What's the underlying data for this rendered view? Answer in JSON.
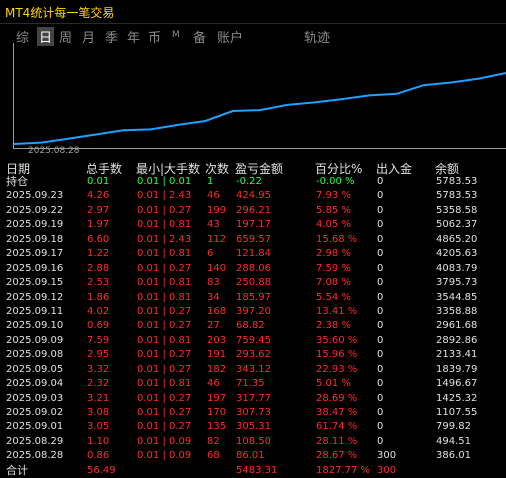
{
  "window": {
    "title": "MT4统计每一笔交易"
  },
  "tabs": [
    {
      "label": "综",
      "active": false
    },
    {
      "label": "日",
      "active": true
    },
    {
      "label": "周",
      "active": false
    },
    {
      "label": "月",
      "active": false
    },
    {
      "label": "季",
      "active": false
    },
    {
      "label": "年",
      "active": false
    },
    {
      "label": "币",
      "active": false
    },
    {
      "label": "M",
      "active": false
    },
    {
      "label": "备",
      "active": false
    },
    {
      "label": "账户",
      "active": false
    },
    {
      "label": "轨迹",
      "active": false
    }
  ],
  "chart_data": {
    "type": "line",
    "x_start_label": "2025.08.28",
    "series": [
      {
        "values": [
          386.01,
          494.51,
          799.82,
          1107.55,
          1425.32,
          1496.67,
          1839.79,
          2133.41,
          2892.86,
          2961.68,
          3358.88,
          3544.85,
          3795.73,
          4083.79,
          4205.63,
          4865.2,
          5062.37,
          5358.58,
          5783.53
        ]
      }
    ],
    "color": "#1ea0ff"
  },
  "table": {
    "headers": [
      "日期",
      "总手数",
      "最小|大手数",
      "次数",
      "盈亏金额",
      "百分比%",
      "出入金",
      "余额"
    ],
    "rows": [
      {
        "style": "pos",
        "cells": [
          "持仓",
          "0.01",
          "0.01 | 0.01",
          "1",
          "-0.22",
          "-0.00 %",
          "0",
          "5783.53"
        ]
      },
      {
        "style": "red",
        "cells": [
          "2025.09.23",
          "4.26",
          "0.01 | 2.43",
          "46",
          "424.95",
          "7.93 %",
          "0",
          "5783.53"
        ]
      },
      {
        "style": "red",
        "cells": [
          "2025.09.22",
          "2.97",
          "0.01 | 0.27",
          "199",
          "296.21",
          "5.85 %",
          "0",
          "5358.58"
        ]
      },
      {
        "style": "red",
        "cells": [
          "2025.09.19",
          "1.97",
          "0.01 | 0.81",
          "43",
          "197.17",
          "4.05 %",
          "0",
          "5062.37"
        ]
      },
      {
        "style": "red",
        "cells": [
          "2025.09.18",
          "6.60",
          "0.01 | 2.43",
          "112",
          "659.57",
          "15.68 %",
          "0",
          "4865.20"
        ]
      },
      {
        "style": "red",
        "cells": [
          "2025.09.17",
          "1.22",
          "0.01 | 0.81",
          "6",
          "121.84",
          "2.98 %",
          "0",
          "4205.63"
        ]
      },
      {
        "style": "red",
        "cells": [
          "2025.09.16",
          "2.88",
          "0.01 | 0.27",
          "140",
          "288.06",
          "7.59 %",
          "0",
          "4083.79"
        ]
      },
      {
        "style": "red",
        "cells": [
          "2025.09.15",
          "2.53",
          "0.01 | 0.81",
          "83",
          "250.88",
          "7.08 %",
          "0",
          "3795.73"
        ]
      },
      {
        "style": "red",
        "cells": [
          "2025.09.12",
          "1.86",
          "0.01 | 0.81",
          "34",
          "185.97",
          "5.54 %",
          "0",
          "3544.85"
        ]
      },
      {
        "style": "red",
        "cells": [
          "2025.09.11",
          "4.02",
          "0.01 | 0.27",
          "168",
          "397.20",
          "13.41 %",
          "0",
          "3358.88"
        ]
      },
      {
        "style": "red",
        "cells": [
          "2025.09.10",
          "0.69",
          "0.01 | 0.27",
          "27",
          "68.82",
          "2.38 %",
          "0",
          "2961.68"
        ]
      },
      {
        "style": "red",
        "cells": [
          "2025.09.09",
          "7.59",
          "0.01 | 0.81",
          "203",
          "759.45",
          "35.60 %",
          "0",
          "2892.86"
        ]
      },
      {
        "style": "red",
        "cells": [
          "2025.09.08",
          "2.95",
          "0.01 | 0.27",
          "191",
          "293.62",
          "15.96 %",
          "0",
          "2133.41"
        ]
      },
      {
        "style": "red",
        "cells": [
          "2025.09.05",
          "3.32",
          "0.01 | 0.27",
          "182",
          "343.12",
          "22.93 %",
          "0",
          "1839.79"
        ]
      },
      {
        "style": "red",
        "cells": [
          "2025.09.04",
          "2.32",
          "0.01 | 0.81",
          "46",
          "71.35",
          "5.01 %",
          "0",
          "1496.67"
        ]
      },
      {
        "style": "red",
        "cells": [
          "2025.09.03",
          "3.21",
          "0.01 | 0.27",
          "197",
          "317.77",
          "28.69 %",
          "0",
          "1425.32"
        ]
      },
      {
        "style": "red",
        "cells": [
          "2025.09.02",
          "3.08",
          "0.01 | 0.27",
          "170",
          "307.73",
          "38.47 %",
          "0",
          "1107.55"
        ]
      },
      {
        "style": "red",
        "cells": [
          "2025.09.01",
          "3.05",
          "0.01 | 0.27",
          "135",
          "305.31",
          "61.74 %",
          "0",
          "799.82"
        ]
      },
      {
        "style": "red",
        "cells": [
          "2025.08.29",
          "1.10",
          "0.01 | 0.09",
          "82",
          "108.50",
          "28.11 %",
          "0",
          "494.51"
        ]
      },
      {
        "style": "red",
        "cells": [
          "2025.08.28",
          "0.86",
          "0.01 | 0.09",
          "68",
          "86.01",
          "28.67 %",
          "300",
          "386.01"
        ]
      },
      {
        "style": "red total",
        "cells": [
          "合计",
          "56.49",
          "",
          "",
          "5483.31",
          "1827.77 %",
          "300",
          ""
        ]
      }
    ]
  }
}
